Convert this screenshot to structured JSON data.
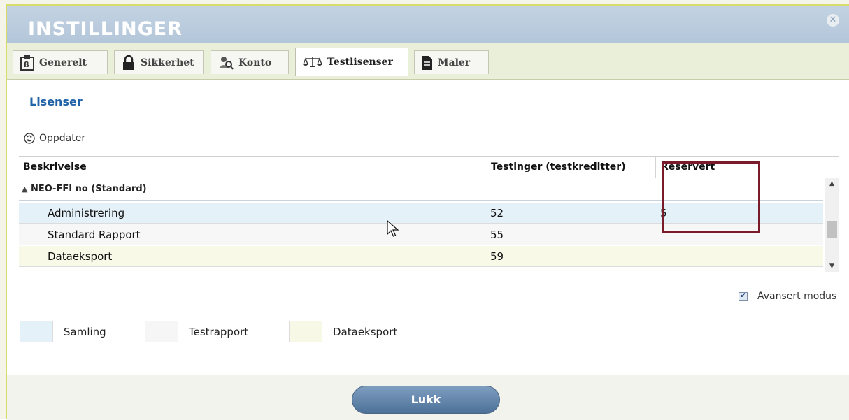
{
  "dialog": {
    "title": "INSTILLINGER",
    "close_icon": "close-circle-icon"
  },
  "tabs": [
    {
      "label": "Generelt",
      "icon": "general-doc-icon",
      "active": false
    },
    {
      "label": "Sikkerhet",
      "icon": "lock-icon",
      "active": false
    },
    {
      "label": "Konto",
      "icon": "user-search-icon",
      "active": false
    },
    {
      "label": "Testlisenser",
      "icon": "balance-scale-icon",
      "active": true
    },
    {
      "label": "Maler",
      "icon": "document-icon",
      "active": false
    }
  ],
  "section": {
    "title": "Lisenser"
  },
  "toolbar": {
    "refresh_label": "Oppdater",
    "refresh_icon": "refresh-icon"
  },
  "table": {
    "columns": [
      "Beskrivelse",
      "Testinger (testkreditter)",
      "Reservert"
    ],
    "group": {
      "label": "NEO-FFI no (Standard)",
      "icon": "collapse-triangle-icon"
    },
    "rows": [
      {
        "name": "Administrering",
        "testinger": "52",
        "reservert": "5",
        "type": "samling"
      },
      {
        "name": "Standard Rapport",
        "testinger": "55",
        "reservert": "",
        "type": "testrapport"
      },
      {
        "name": "Dataeksport",
        "testinger": "59",
        "reservert": "",
        "type": "dataeksport"
      }
    ]
  },
  "advanced_mode": {
    "label": "Avansert modus",
    "checked": true
  },
  "legend": [
    {
      "label": "Samling",
      "color": "#e5f1f8"
    },
    {
      "label": "Testrapport",
      "color": "#f6f6f6"
    },
    {
      "label": "Dataeksport",
      "color": "#f8f8e6"
    }
  ],
  "footer": {
    "close_label": "Lukk"
  },
  "colors": {
    "highlight_box": "#7a1b2a",
    "section_title": "#2163a8",
    "header_bg": "#b3c6d9"
  }
}
